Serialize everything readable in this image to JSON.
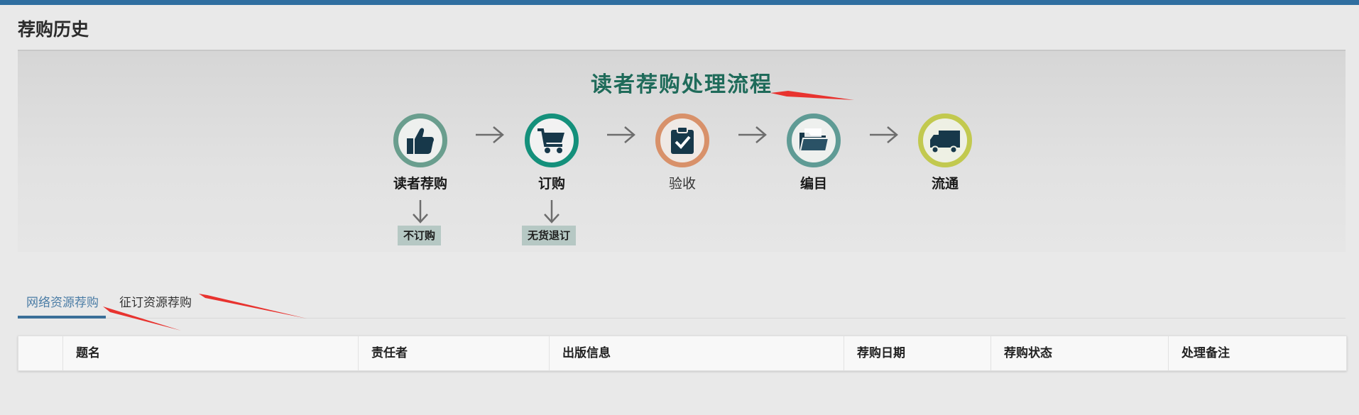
{
  "page": {
    "title": "荐购历史"
  },
  "process": {
    "title": "读者荐购处理流程",
    "steps": [
      {
        "label": "读者荐购",
        "icon": "thumbs-up-icon",
        "color": "#6a9e8e"
      },
      {
        "label": "订购",
        "icon": "shopping-cart-icon",
        "color": "#14907b"
      },
      {
        "label": "验收",
        "icon": "clipboard-check-icon",
        "color": "#d8916a"
      },
      {
        "label": "编目",
        "icon": "folder-icon",
        "color": "#5f9b95"
      },
      {
        "label": "流通",
        "icon": "truck-icon",
        "color": "#c2c94f"
      }
    ],
    "branches": [
      {
        "label": "不订购"
      },
      {
        "label": "无货退订"
      }
    ]
  },
  "tabs": [
    {
      "label": "网络资源荐购",
      "active": true
    },
    {
      "label": "征订资源荐购",
      "active": false
    }
  ],
  "table": {
    "columns": [
      "",
      "题名",
      "责任者",
      "出版信息",
      "荐购日期",
      "荐购状态",
      "处理备注"
    ]
  },
  "colors": {
    "topbar": "#2f6ea0",
    "accent": "#3a6f98",
    "annotation": "#e8332f"
  }
}
